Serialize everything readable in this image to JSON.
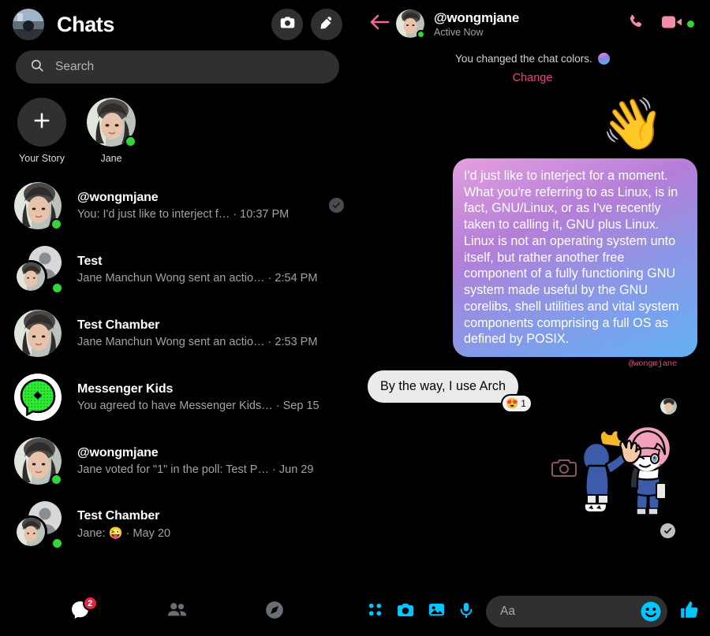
{
  "left": {
    "header": {
      "title": "Chats",
      "avatar_name": "user-avatar",
      "camera_icon": "camera-icon",
      "compose_icon": "pencil-compose-icon"
    },
    "search": {
      "placeholder": "Search",
      "icon": "search-icon"
    },
    "stories": [
      {
        "label": "Your Story",
        "type": "add",
        "icon": "plus-icon",
        "online": false
      },
      {
        "label": "Jane",
        "type": "avatar",
        "online": true
      }
    ],
    "threads": [
      {
        "name": "@wongmjane",
        "preview": "You: I'd just like to interject f…",
        "time": "10:37 PM",
        "separator": "·",
        "avatar": "jane",
        "online": true,
        "seen": true
      },
      {
        "name": "Test",
        "preview": "Jane Manchun Wong sent an actio…",
        "time": "2:54 PM",
        "separator": "·",
        "avatar": "group",
        "online": true,
        "seen": false
      },
      {
        "name": "Test Chamber",
        "preview": "Jane Manchun Wong sent an actio…",
        "time": "2:53 PM",
        "separator": "·",
        "avatar": "jane",
        "online": false,
        "seen": false
      },
      {
        "name": "Messenger Kids",
        "preview": "You agreed to have Messenger Kids…",
        "time": "Sep 15",
        "separator": "·",
        "avatar": "messenger-kids",
        "online": false,
        "seen": false
      },
      {
        "name": "@wongmjane",
        "preview": "Jane voted for \"1\" in the poll: Test P…",
        "time": "Jun 29",
        "separator": "·",
        "avatar": "jane",
        "online": true,
        "seen": false
      },
      {
        "name": "Test Chamber",
        "preview": "Jane: 😜",
        "time": "May 20",
        "separator": "·",
        "avatar": "group",
        "online": true,
        "seen": false
      }
    ],
    "nav": [
      {
        "name": "chats-tab",
        "icon": "chat-bubble-icon",
        "badge": "2",
        "active": true
      },
      {
        "name": "people-tab",
        "icon": "people-icon",
        "badge": null,
        "active": false
      },
      {
        "name": "discover-tab",
        "icon": "compass-icon",
        "badge": null,
        "active": false
      }
    ]
  },
  "right": {
    "header": {
      "back_icon": "back-arrow-icon",
      "name": "@wongmjane",
      "status": "Active Now",
      "call_icon": "phone-icon",
      "video_icon": "video-camera-icon",
      "online": true
    },
    "system_note": {
      "text": "You changed the chat colors.",
      "action": "Change",
      "swatch": "chat-color-swatch"
    },
    "messages": [
      {
        "kind": "emoji",
        "value": "👋",
        "side": "out"
      },
      {
        "kind": "text",
        "side": "out",
        "text": "I'd just like to interject for a moment. What you're referring to as Linux, is in fact, GNU/Linux, or as I've recently taken to calling it, GNU plus Linux. Linux is not an operating system unto itself, but rather another free component of a fully functioning GNU system made useful by the GNU corelibs, shell utilities and vital system components comprising a full OS as defined by POSIX.",
        "tag": "@wongmjane"
      },
      {
        "kind": "text",
        "side": "in",
        "text": "By the way, I use Arch",
        "reaction": {
          "emoji": "😍",
          "count": "1"
        }
      },
      {
        "kind": "sticker",
        "side": "out",
        "name": "high-five-sticker",
        "delivered": true
      }
    ],
    "composer": {
      "placeholder": "Aa",
      "icons": [
        "apps-grid-icon",
        "camera-icon",
        "gallery-icon",
        "microphone-icon"
      ],
      "emoji_icon": "smiley-icon",
      "like_icon": "thumbs-up-icon"
    }
  },
  "colors": {
    "accent_pink": "#f58ca8",
    "link_pink": "#e8437f",
    "composer_cyan": "#00c6ff",
    "online_green": "#31d63a",
    "badge_red": "#e42645",
    "bubble_gradient_start": "#e4a0df",
    "bubble_gradient_end": "#62b0f3",
    "surface": "#303030",
    "background": "#000000"
  }
}
